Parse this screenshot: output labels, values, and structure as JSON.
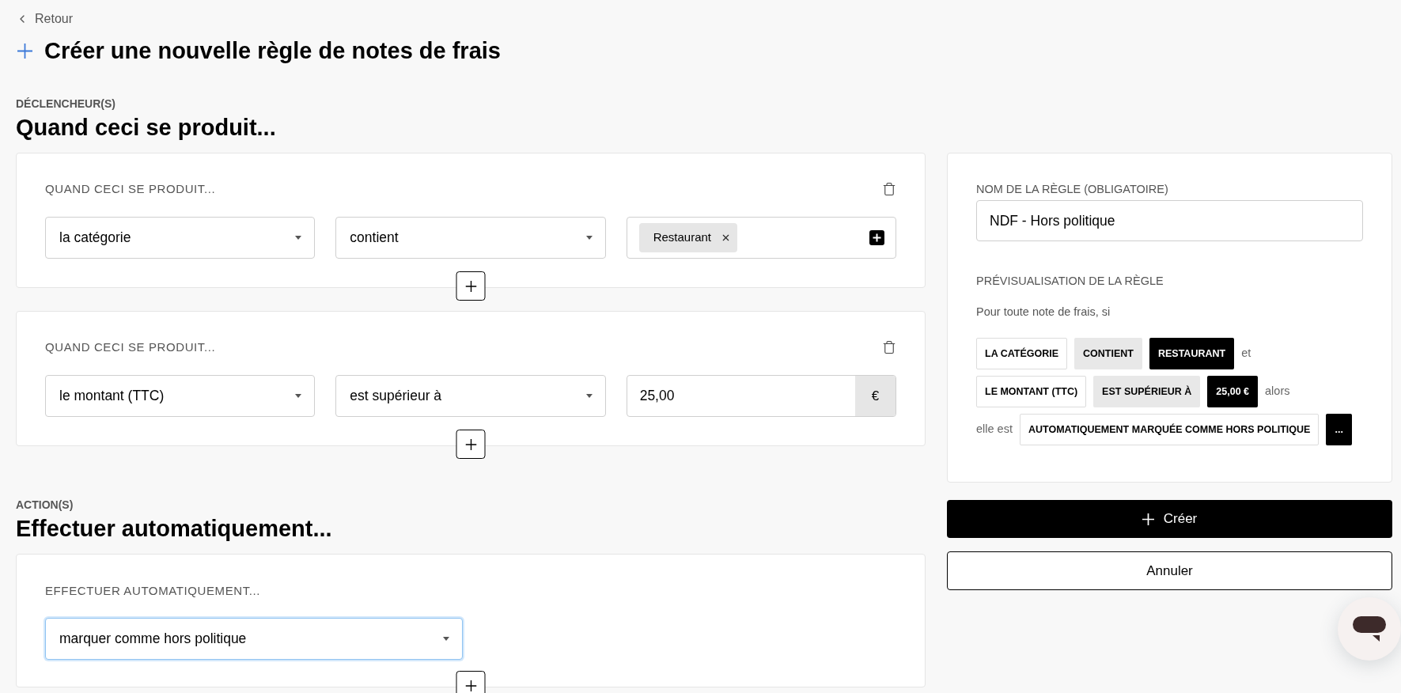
{
  "back_link": {
    "label": "Retour"
  },
  "page_title": "Créer une nouvelle règle de notes de frais",
  "triggers_section": {
    "eyebrow": "DÉCLENCHEUR(S)",
    "heading": "Quand ceci se produit...",
    "conditions": [
      {
        "label": "QUAND CECI SE PRODUIT...",
        "field": "la catégorie",
        "operator": "contient",
        "value": {
          "kind": "tags",
          "tags": [
            {
              "label": "Restaurant"
            }
          ]
        }
      },
      {
        "label": "QUAND CECI SE PRODUIT...",
        "field": "le montant (TTC)",
        "operator": "est supérieur à",
        "value": {
          "kind": "amount",
          "amount": "25,00",
          "currency": "€"
        }
      }
    ]
  },
  "actions_section": {
    "eyebrow": "ACTION(S)",
    "heading": "Effectuer automatiquement...",
    "actions": [
      {
        "label": "EFFECTUER AUTOMATIQUEMENT...",
        "action": "marquer comme hors politique",
        "focused": true
      }
    ]
  },
  "rule_panel": {
    "name_label": "NOM DE LA RÈGLE (OBLIGATOIRE)",
    "name_value": "NDF - Hors politique",
    "preview_label": "PRÉVISUALISATION DE LA RÈGLE",
    "preview_intro": "Pour toute note de frais, si",
    "preview_lines": [
      {
        "items": [
          {
            "kind": "field",
            "text": "LA CATÉGORIE"
          },
          {
            "kind": "operator",
            "text": "CONTIENT"
          },
          {
            "kind": "value",
            "text": "RESTAURANT"
          },
          {
            "kind": "text",
            "text": "et"
          }
        ]
      },
      {
        "items": [
          {
            "kind": "field",
            "text": "LE MONTANT (TTC)"
          },
          {
            "kind": "operator",
            "text": "EST SUPÉRIEUR À"
          },
          {
            "kind": "value",
            "text": "25,00 €"
          },
          {
            "kind": "text",
            "text": "alors"
          }
        ]
      },
      {
        "items": [
          {
            "kind": "text",
            "text": "elle est"
          },
          {
            "kind": "field",
            "text": "AUTOMATIQUEMENT MARQUÉE COMME HORS POLITIQUE"
          },
          {
            "kind": "value",
            "text": "..."
          }
        ]
      }
    ]
  },
  "buttons": [
    {
      "kind": "primary",
      "label": "Créer"
    },
    {
      "kind": "secondary",
      "label": "Annuler"
    }
  ]
}
